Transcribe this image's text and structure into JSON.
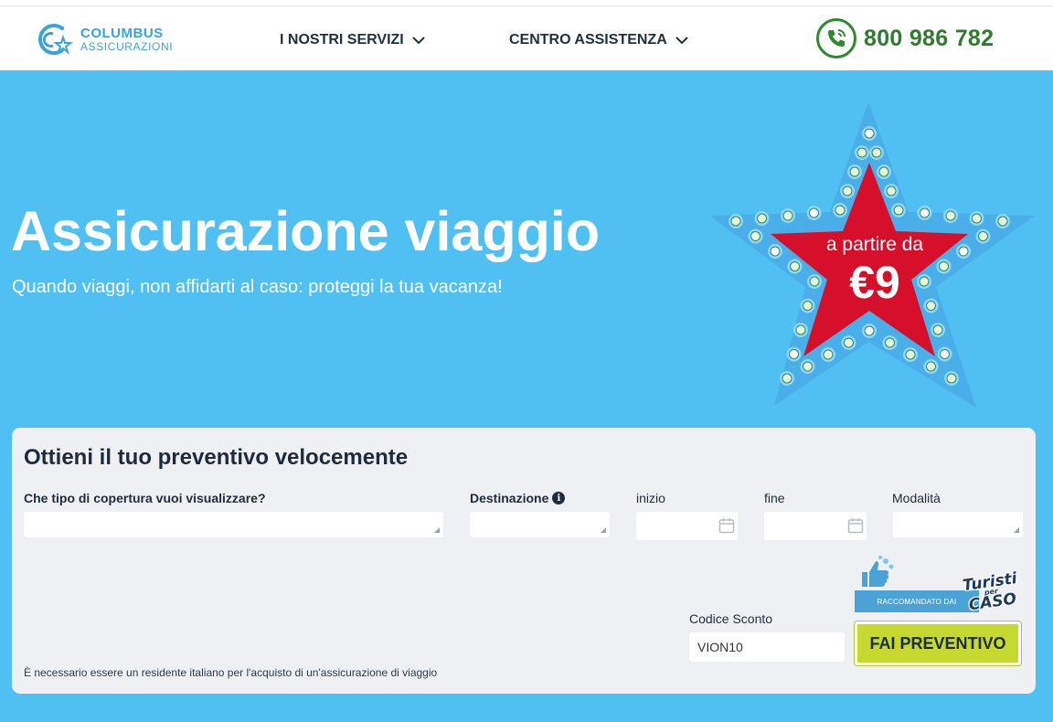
{
  "header": {
    "logo": {
      "name": "COLUMBUS",
      "sub": "ASSICURAZIONI"
    },
    "nav": [
      {
        "label": "I NOSTRI SERVIZI"
      },
      {
        "label": "CENTRO ASSISTENZA"
      }
    ],
    "phone": "800 986 782"
  },
  "hero": {
    "title": "Assicurazione viaggio",
    "subtitle": "Quando viaggi, non affidarti al caso: proteggi la tua vacanza!",
    "star": {
      "label": "a partire da",
      "price": "€9"
    }
  },
  "form": {
    "title": "Ottieni il tuo preventivo velocemente",
    "coverage_label": "Che tipo di copertura vuoi visualizzare?",
    "destination_label": "Destinazione",
    "start_label": "inizio",
    "end_label": "fine",
    "mode_label": "Modalità",
    "discount_label": "Codice Sconto",
    "discount_value": "VION10",
    "badge": {
      "ribbon": "RACCOMANDATO DAI",
      "brand_top": "Turisti",
      "brand_mid": "per",
      "brand_bottom": "CASO"
    },
    "submit_label": "FAI PREVENTIVO",
    "disclaimer": "È necessario essere un residente italiano per l'acquisto di un'assicurazione di viaggio"
  },
  "colors": {
    "hero_bg": "#50bff2",
    "accent_green": "#c6d930",
    "phone_green": "#2e7d2e",
    "star_red": "#d6102a"
  }
}
